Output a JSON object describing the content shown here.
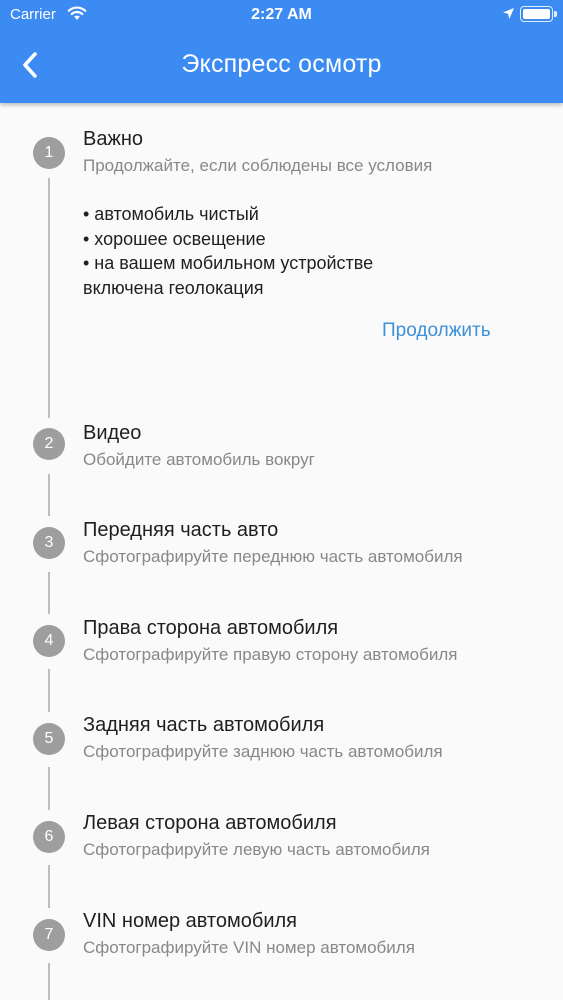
{
  "status_bar": {
    "carrier": "Carrier",
    "time": "2:27 AM"
  },
  "header": {
    "title": "Экспресс осмотр"
  },
  "colors": {
    "app_bar": "#3b8bf3",
    "step_circle": "#9e9e9e",
    "link": "#3d91d8"
  },
  "steps": [
    {
      "number": "1",
      "title": "Важно",
      "subtitle": "Продолжайте, если соблюдены все условия"
    },
    {
      "number": "2",
      "title": "Видео",
      "subtitle": "Обойдите автомобиль вокруг"
    },
    {
      "number": "3",
      "title": "Передняя часть авто",
      "subtitle": "Сфотографируйте переднюю часть автомобиля"
    },
    {
      "number": "4",
      "title": "Права сторона автомобиля",
      "subtitle": "Сфотографируйте правую сторону автомобиля"
    },
    {
      "number": "5",
      "title": "Задняя часть автомобиля",
      "subtitle": "Сфотографируйте заднюю часть автомобиля"
    },
    {
      "number": "6",
      "title": "Левая сторона автомобиля",
      "subtitle": "Сфотографируйте левую часть автомобиля"
    },
    {
      "number": "7",
      "title": "VIN номер автомобиля",
      "subtitle": "Сфотографируйте VIN номер автомобиля"
    }
  ],
  "conditions": [
    "• автомобиль чистый",
    "• хорошее освещение",
    "• на вашем мобильном устройстве",
    "включена геолокация"
  ],
  "continue_label": "Продолжить"
}
